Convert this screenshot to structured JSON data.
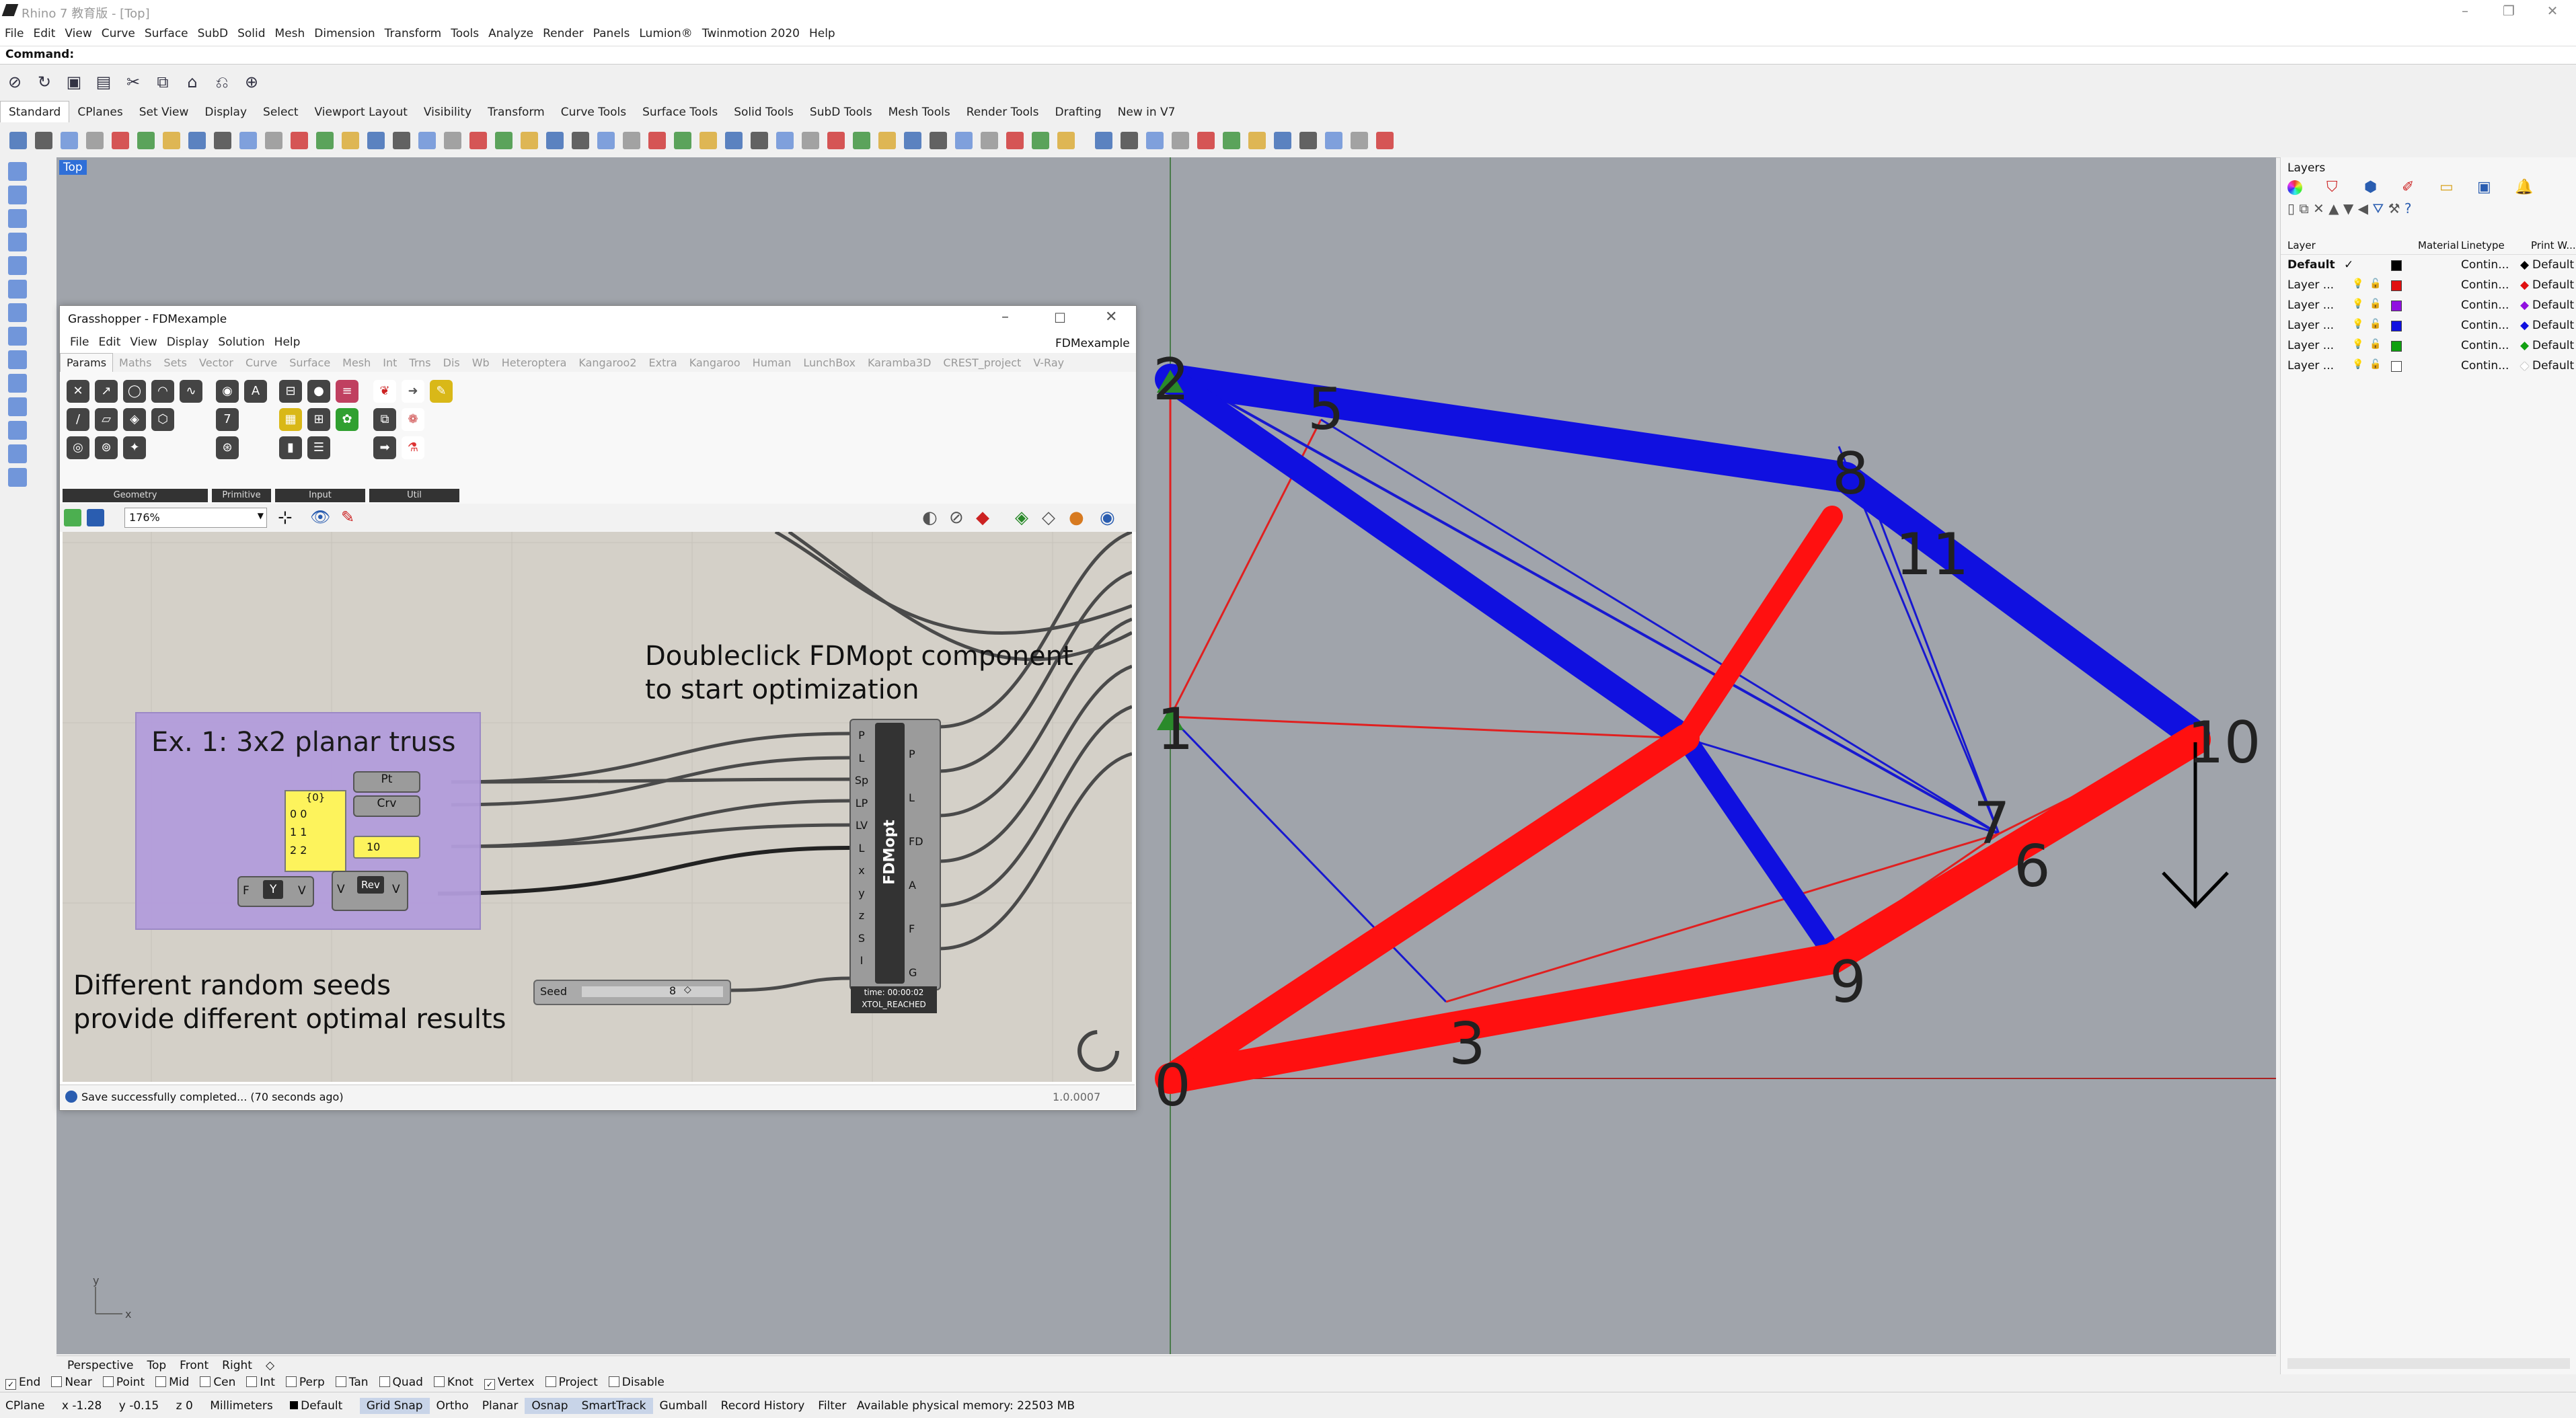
{
  "window": {
    "title": "Rhino 7 教育版 - [Top]",
    "menu": [
      "File",
      "Edit",
      "View",
      "Curve",
      "Surface",
      "SubD",
      "Solid",
      "Mesh",
      "Dimension",
      "Transform",
      "Tools",
      "Analyze",
      "Render",
      "Panels",
      "Lumion®",
      "Twinmotion 2020",
      "Help"
    ]
  },
  "command": {
    "label": "Command:"
  },
  "toolbar_tabs": [
    "Standard",
    "CPlanes",
    "Set View",
    "Display",
    "Select",
    "Viewport Layout",
    "Visibility",
    "Transform",
    "Curve Tools",
    "Surface Tools",
    "Solid Tools",
    "SubD Tools",
    "Mesh Tools",
    "Render Tools",
    "Drafting",
    "New in V7"
  ],
  "viewport": {
    "name": "Top",
    "axis_y": "y",
    "axis_x": "x",
    "node_labels": [
      "2",
      "5",
      "8",
      "11",
      "1",
      "10",
      "7",
      "6",
      "0",
      "3",
      "9"
    ],
    "colors": {
      "compression": "#1010e0",
      "tension": "#ff1010",
      "support": "#2a8a2a",
      "background": "#a0a4ab"
    }
  },
  "layers_panel": {
    "title": "Layers",
    "columns": [
      "Layer",
      "Material",
      "Linetype",
      "Print W..."
    ],
    "rows": [
      {
        "name": "Default",
        "check": "✓",
        "linetype": "Contin...",
        "print": "Default",
        "color": "#000000"
      },
      {
        "name": "Layer ...",
        "linetype": "Contin...",
        "print": "Default",
        "color": "#e01010"
      },
      {
        "name": "Layer ...",
        "linetype": "Contin...",
        "print": "Default",
        "color": "#9010e0"
      },
      {
        "name": "Layer ...",
        "linetype": "Contin...",
        "print": "Default",
        "color": "#1010e0"
      },
      {
        "name": "Layer ...",
        "linetype": "Contin...",
        "print": "Default",
        "color": "#10a010"
      },
      {
        "name": "Layer ...",
        "linetype": "Contin...",
        "print": "Default",
        "color": "#ffffff"
      }
    ]
  },
  "grasshopper": {
    "title": "Grasshopper - FDMexample",
    "menu": [
      "File",
      "Edit",
      "View",
      "Display",
      "Solution",
      "Help"
    ],
    "doc_name": "FDMexample",
    "tabs": [
      "Params",
      "Maths",
      "Sets",
      "Vector",
      "Curve",
      "Surface",
      "Mesh",
      "Int",
      "Trns",
      "Dis",
      "Wb",
      "Heteroptera",
      "Kangaroo2",
      "Extra",
      "Kangaroo",
      "Human",
      "LunchBox",
      "Karamba3D",
      "CREST_project",
      "V-Ray"
    ],
    "groups": [
      "Geometry",
      "Primitive",
      "Input",
      "Util"
    ],
    "zoom": "176%",
    "note_optimize": "Doubleclick FDMopt component\nto start optimization",
    "note_seeds": "Different random seeds\nprovide different optimal results",
    "group_title": "Ex. 1: 3x2 planar truss",
    "panel_header": "{0}",
    "panel_rows": [
      "0  0",
      "1  1",
      "2  2"
    ],
    "param_pt": "Pt",
    "param_crv": "Crv",
    "number_value": "10",
    "comp_f": "F",
    "comp_y": "Y",
    "comp_v": "V",
    "comp_rev": "Rev",
    "fdm_name": "FDMopt",
    "fdm_inputs": [
      "P",
      "L",
      "Sp",
      "LP",
      "LV",
      "L",
      "x",
      "y",
      "z",
      "S",
      "I"
    ],
    "fdm_outputs": [
      "P",
      "L",
      "FD",
      "A",
      "F",
      "G"
    ],
    "fdm_time": "time: 00:00:02",
    "fdm_status": "XTOL_REACHED",
    "seed_label": "Seed",
    "seed_value": "8",
    "status_text": "Save successfully completed... (70 seconds ago)",
    "version": "1.0.0007"
  },
  "viewport_tabs": [
    "Perspective",
    "Top",
    "Front",
    "Right"
  ],
  "osnaps": [
    {
      "label": "End",
      "checked": true
    },
    {
      "label": "Near",
      "checked": false
    },
    {
      "label": "Point",
      "checked": false
    },
    {
      "label": "Mid",
      "checked": false
    },
    {
      "label": "Cen",
      "checked": false
    },
    {
      "label": "Int",
      "checked": false
    },
    {
      "label": "Perp",
      "checked": false
    },
    {
      "label": "Tan",
      "checked": false
    },
    {
      "label": "Quad",
      "checked": false
    },
    {
      "label": "Knot",
      "checked": false
    },
    {
      "label": "Vertex",
      "checked": true
    },
    {
      "label": "Project",
      "checked": false
    },
    {
      "label": "Disable",
      "checked": false
    }
  ],
  "statusbar": {
    "cplane": "CPlane",
    "x": "x -1.28",
    "y": "y -0.15",
    "z": "z 0",
    "units": "Millimeters",
    "layer": "Default",
    "buttons": [
      "Grid Snap",
      "Ortho",
      "Planar",
      "Osnap",
      "SmartTrack",
      "Gumball",
      "Record History",
      "Filter"
    ],
    "memory": "Available physical memory: 22503 MB"
  }
}
